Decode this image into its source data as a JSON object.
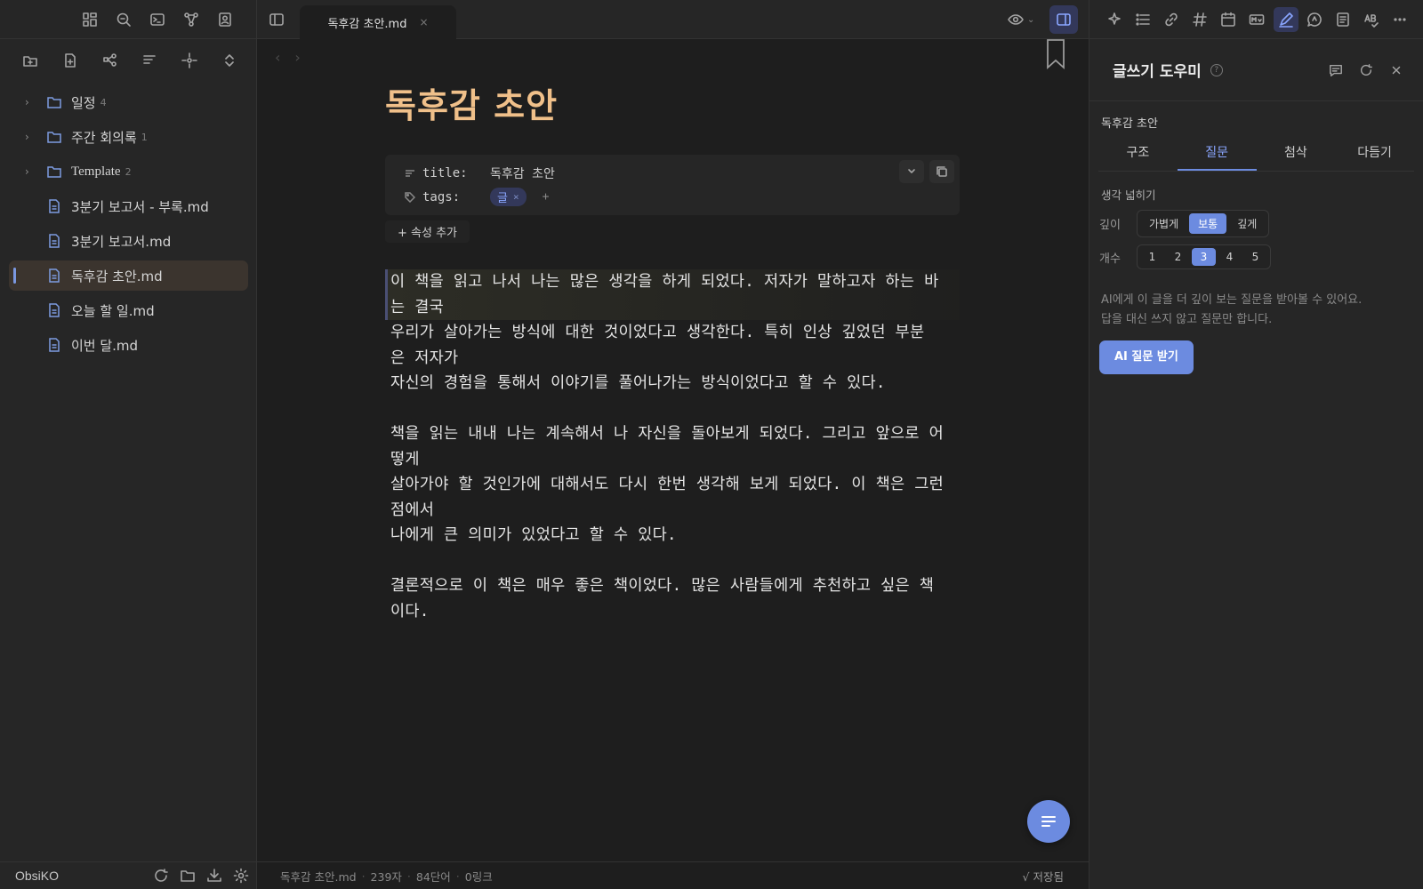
{
  "left_sidebar": {
    "tree": [
      {
        "kind": "folder",
        "label": "일정",
        "count": "4"
      },
      {
        "kind": "folder",
        "label": "주간 회의록",
        "count": "1"
      },
      {
        "kind": "folder",
        "label": "Template",
        "count": "2"
      },
      {
        "kind": "file",
        "label": "3분기 보고서 - 부록.md"
      },
      {
        "kind": "file",
        "label": "3분기 보고서.md"
      },
      {
        "kind": "file",
        "label": "독후감 초안.md",
        "active": true
      },
      {
        "kind": "file",
        "label": "오늘 할 일.md"
      },
      {
        "kind": "file",
        "label": "이번 달.md"
      }
    ],
    "vault_name": "ObsiKO"
  },
  "editor": {
    "tab_title": "독후감 초안.md",
    "tab_close": "×",
    "doc_title": "독후감 초안",
    "properties": {
      "title_key": "title:",
      "title_value": "독후감 초안",
      "tags_key": "tags:",
      "tag": "글",
      "tag_remove": "×",
      "tag_add": "+",
      "add_property": "+ 속성 추가"
    },
    "paragraphs": [
      "이 책을 읽고 나서 나는 많은 생각을 하게 되었다. 저자가 말하고자 하는 바\n는 결국\n",
      "우리가 살아가는 방식에 대한 것이었다고 생각한다. 특히 인상 깊었던 부분\n은 저자가\n자신의 경험을 통해서 이야기를 풀어나가는 방식이었다고 할 수 있다.",
      "책을 읽는 내내 나는 계속해서 나 자신을 돌아보게 되었다. 그리고 앞으로 어\n떻게\n살아가야 할 것인가에 대해서도 다시 한번 생각해 보게 되었다. 이 책은 그런\n점에서\n나에게 큰 의미가 있었다고 할 수 있다.",
      "결론적으로 이 책은 매우 좋은 책이었다. 많은 사람들에게 추천하고 싶은 책\n이다."
    ],
    "status": {
      "file": "독후감 초안.md",
      "chars": "239자",
      "words": "84단어",
      "links": "0링크",
      "saved": "√ 저장됨"
    }
  },
  "right_panel": {
    "title": "글쓰기 도우미",
    "help": "?",
    "doc_name": "독후감 초안",
    "tabs": [
      "구조",
      "질문",
      "첨삭",
      "다듬기"
    ],
    "active_tab": "질문",
    "section": "생각 넓히기",
    "depth_label": "깊이",
    "depth_options": [
      "가볍게",
      "보통",
      "깊게"
    ],
    "depth_selected": "보통",
    "count_label": "개수",
    "count_options": [
      "1",
      "2",
      "3",
      "4",
      "5"
    ],
    "count_selected": "3",
    "help_text": "AI에게 이 글을 더 깊이 보는 질문을 받아볼 수 있어요.\n답을 대신 쓰지 않고 질문만 합니다.",
    "ask_button": "AI 질문 받기"
  },
  "colors": {
    "accent": "#6c8be0",
    "title": "#f0c08a",
    "background": "#1e1e1e",
    "panel": "#262626"
  }
}
